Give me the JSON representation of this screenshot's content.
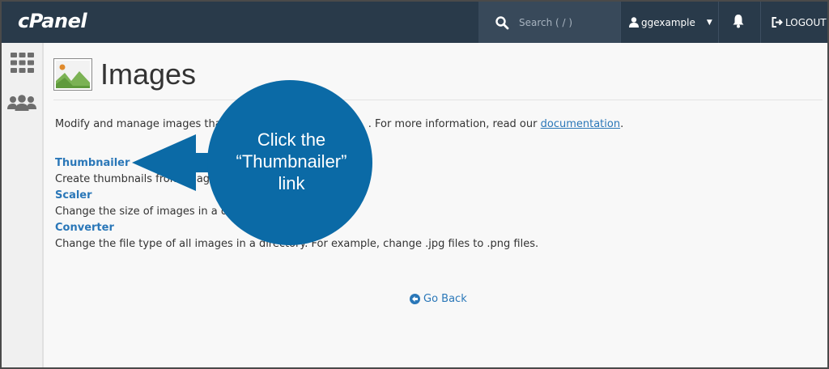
{
  "header": {
    "logo": "cPanel",
    "search_placeholder": "Search ( / )",
    "username": "ggexample",
    "logout_label": "LOGOUT"
  },
  "sidebar": {
    "items": [
      {
        "icon": "grid-icon",
        "name": "Home"
      },
      {
        "icon": "users-icon",
        "name": "User Manager"
      }
    ]
  },
  "page": {
    "title": "Images",
    "description_start": "Modify and manage images tha",
    "description_end": ". For more information, read our ",
    "documentation_link": "documentation",
    "description_period": "."
  },
  "tools": [
    {
      "label": "Thumbnailer",
      "description": "Create thumbnails from imag"
    },
    {
      "label": "Scaler",
      "description": "Change the size of images in a di"
    },
    {
      "label": "Converter",
      "description": "Change the file type of all images in a directory. For example, change .jpg files to .png files."
    }
  ],
  "footer": {
    "go_back": "Go Back"
  },
  "annotation": {
    "line1": "Click the",
    "line2": "“Thumbnailer”",
    "line3": "link"
  },
  "colors": {
    "topbar": "#293a4a",
    "link": "#2a77b8",
    "callout": "#0b6aa6"
  }
}
